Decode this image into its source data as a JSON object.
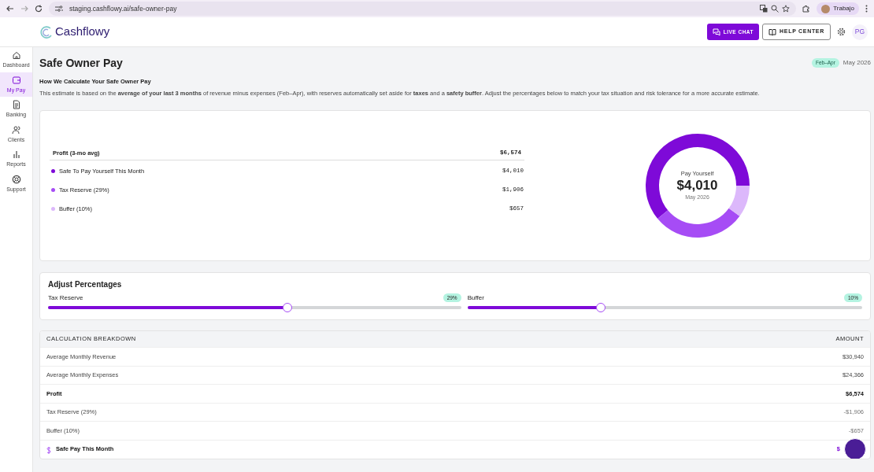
{
  "browser": {
    "url": "staging.cashflowy.ai/safe-owner-pay",
    "profile_name": "Trabajo"
  },
  "header": {
    "logo_text": "Cashflowy",
    "buttons": [
      {
        "label": "LIVE CHAT",
        "kind": "primary"
      },
      {
        "label": "HELP CENTER",
        "kind": "outline"
      }
    ],
    "avatar_initials": "PG"
  },
  "sidebar": {
    "items": [
      {
        "label": "Dashboard",
        "selected": false
      },
      {
        "label": "My Pay",
        "selected": true
      },
      {
        "label": "Banking",
        "selected": false
      },
      {
        "label": "Clients",
        "selected": false
      },
      {
        "label": "Reports",
        "selected": false
      },
      {
        "label": "Support",
        "selected": false
      }
    ]
  },
  "page": {
    "title": "Safe Owner Pay",
    "period_badge": "Feb–Apr",
    "period_label": "May 2026",
    "explainer_title": "How We Calculate Your Safe Owner Pay",
    "explainer_text": "This estimate is based on the **average of your last 3 months** of revenue minus expenses (Feb–Apr), with reserves automatically set aside for **taxes** and a **safety buffer**. Adjust the percentages below to match your tax situation and risk tolerance for a more accurate estimate."
  },
  "summary": {
    "total_label": "Profit (3-mo avg)",
    "total_value": "$6,574",
    "legend": [
      {
        "value": "$4,010",
        "color": "#7e0ad8"
      },
      {
        "value": "$1,906",
        "color": "#a64cf5"
      },
      {
        "value": "$657",
        "color": "#dcb8fb"
      }
    ],
    "center": {
      "label": "Pay Yourself",
      "value": "$4,010",
      "sub": "May 2026"
    },
    "chart_data": {
      "type": "donut",
      "categories": [
        "Safe To Pay Yourself This Month",
        "Tax Reserve (29%)",
        "Buffer (10%)"
      ],
      "values": [
        61,
        29,
        10
      ]
    }
  },
  "adjust": {
    "title": "Adjust Percentages",
    "sliders": [
      {
        "label": "Tax Reserve",
        "badge": "29%",
        "level": 0.58
      },
      {
        "label": "Buffer",
        "badge": "10%",
        "level": 0.337
      }
    ]
  },
  "breakdown": {
    "columns": [
      "CALCULATION BREAKDOWN",
      "AMOUNT"
    ],
    "rows": [
      {
        "label": "Average Monthly Revenue",
        "amount": "$30,940",
        "kind": "normal"
      },
      {
        "label": "Average Monthly Expenses",
        "amount": "$24,366",
        "kind": "normal"
      },
      {
        "label": "Profit",
        "amount": "$6,574",
        "kind": "total"
      },
      {
        "label": "Tax Reserve (29%)",
        "amount": "-$1,906",
        "kind": "deduction"
      },
      {
        "label": "Buffer (10%)",
        "amount": "-$657",
        "kind": "deduction"
      },
      {
        "label": "Safe Pay This Month",
        "amount": "$",
        "kind": "result"
      }
    ]
  }
}
